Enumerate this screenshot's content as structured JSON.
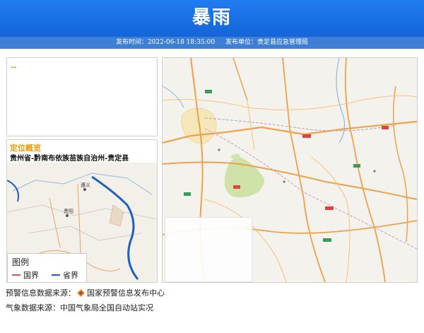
{
  "header": {
    "title": "暴雨",
    "publish_time": "发布时间：2022-06-18 18:35:00",
    "publisher": "发布单位：贵定县应急管理局"
  },
  "text_panel": {
    "marker": "--"
  },
  "location": {
    "title": "定位概览",
    "path": "贵州省-黔南布依族苗族自治州-贵定县",
    "city_labels": [
      "贵阳",
      "遵义"
    ]
  },
  "legend": {
    "title": "图例",
    "items": [
      {
        "label": "国界",
        "color": "#d9534f"
      },
      {
        "label": "省界",
        "color": "#1f5fbf"
      }
    ]
  },
  "footer": {
    "source1_prefix": "预警信息数据来源：",
    "source1_name": "国家预警信息发布中心",
    "source2": "气象数据来源：中国气象局全国自动站实况"
  }
}
